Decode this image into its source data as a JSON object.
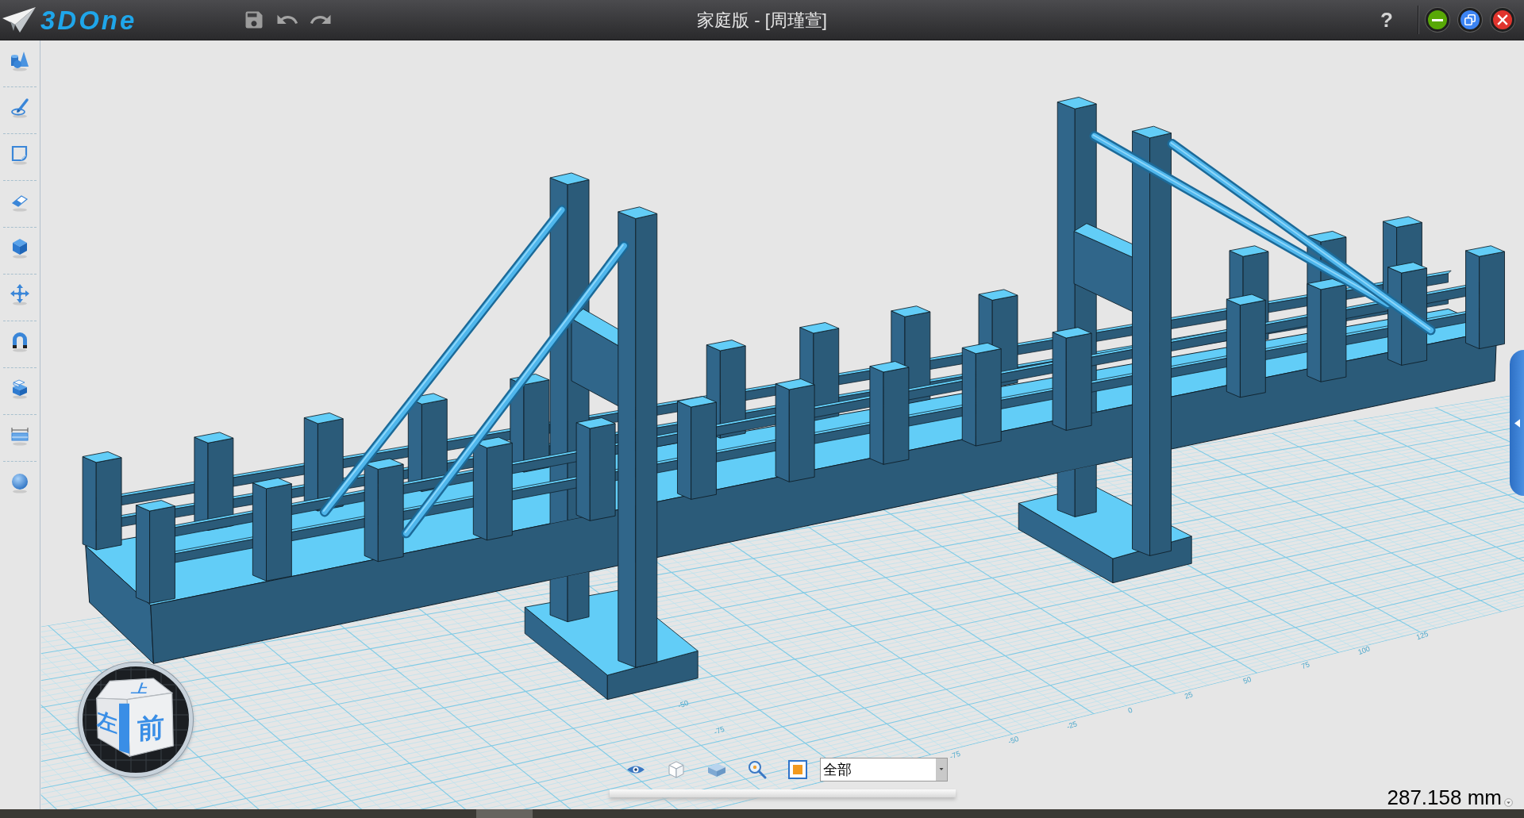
{
  "window": {
    "logo": "3DOne",
    "title": "家庭版 - [周瑾萱]",
    "help": "?"
  },
  "viewport": {
    "grid_labels": {
      "x_axis": [
        "-75",
        "-50",
        "-25",
        "0",
        "25",
        "50",
        "75",
        "100",
        "125"
      ],
      "y_axis": [
        "-50",
        "-75"
      ]
    },
    "view_cube": {
      "faces": [
        {
          "kind": "top",
          "label": "上"
        },
        {
          "kind": "left",
          "label": "左"
        },
        {
          "kind": "front",
          "label": "前"
        }
      ]
    },
    "display_filter": {
      "value": "全部"
    },
    "measurement": "287.158 mm"
  }
}
